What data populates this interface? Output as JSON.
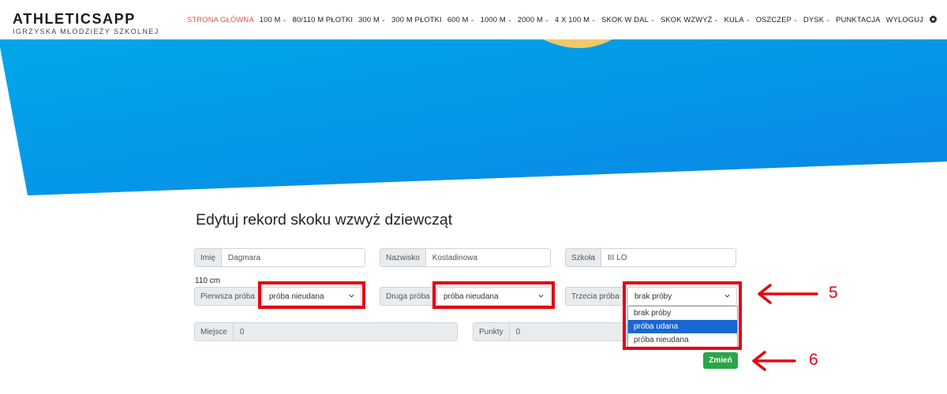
{
  "brand": {
    "title": "ATHLETICSAPP",
    "subtitle": "IGRZYSKA MŁODZIEŻY SZKOLNEJ"
  },
  "nav": {
    "items": [
      {
        "label": "STRONA GŁÓWNA",
        "active": true,
        "dropdown": false
      },
      {
        "label": "100 M",
        "dropdown": true
      },
      {
        "label": "80/110 M PŁOTKI",
        "dropdown": false
      },
      {
        "label": "300 M",
        "dropdown": true
      },
      {
        "label": "300 M PŁOTKI",
        "dropdown": false
      },
      {
        "label": "600 M",
        "dropdown": true
      },
      {
        "label": "1000 M",
        "dropdown": true
      },
      {
        "label": "2000 M",
        "dropdown": true
      },
      {
        "label": "4 X 100 M",
        "dropdown": true
      },
      {
        "label": "SKOK W DAL",
        "dropdown": true
      },
      {
        "label": "SKOK WZWYŻ",
        "dropdown": true
      },
      {
        "label": "KULA",
        "dropdown": true
      },
      {
        "label": "OSZCZEP",
        "dropdown": true
      },
      {
        "label": "DYSK",
        "dropdown": true
      },
      {
        "label": "PUNKTACJA",
        "dropdown": false
      },
      {
        "label": "WYLOGUJ",
        "dropdown": false
      }
    ],
    "settings_icon": "gear-icon",
    "active_color": "#e84c4c"
  },
  "page": {
    "title": "Edytuj rekord skoku wzwyż dziewcząt"
  },
  "form": {
    "imie": {
      "label": "Imię",
      "value": "Dagmara"
    },
    "nazwisko": {
      "label": "Nazwisko",
      "value": "Kostadinowa"
    },
    "szkola": {
      "label": "Szkoła",
      "value": "III LO"
    },
    "height_label": "110 cm",
    "attempt1": {
      "label": "Pierwsza próba",
      "value": "próba nieudana"
    },
    "attempt2": {
      "label": "Druga próba",
      "value": "próba nieudana"
    },
    "attempt3": {
      "label": "Trzecia próba",
      "value": "brak próby"
    },
    "attempt_options": [
      "brak próby",
      "próba udana",
      "próba nieudana"
    ],
    "highlighted_option": "próba udana",
    "miejsce": {
      "label": "Miejsce",
      "value": "0"
    },
    "punkty": {
      "label": "Punkty",
      "value": "0"
    },
    "submit_label": "Zmień"
  },
  "annotations": {
    "step5": "5",
    "step6": "6",
    "color": "#e30613"
  },
  "colors": {
    "hero_start": "#00a6e6",
    "hero_end": "#0a84e8",
    "button": "#28a745",
    "highlight": "#1967d2"
  }
}
